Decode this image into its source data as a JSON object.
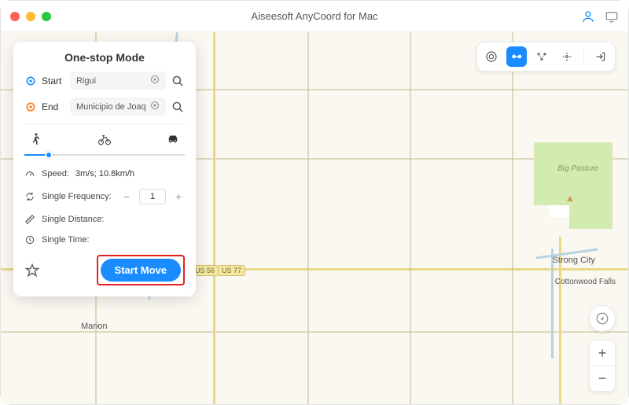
{
  "titlebar": {
    "title": "Aiseesoft AnyCoord for Mac"
  },
  "panel": {
    "title": "One-stop Mode",
    "start_label": "Start",
    "start_value": "Rigui",
    "end_label": "End",
    "end_value": "Municipio de Joaquín V. Gon",
    "speed_label": "Speed:",
    "speed_value": "3m/s; 10.8km/h",
    "frequency_label": "Single Frequency:",
    "frequency_value": "1",
    "distance_label": "Single Distance:",
    "distance_value": "",
    "time_label": "Single Time:",
    "time_value": "",
    "start_move": "Start Move"
  },
  "map": {
    "shields": [
      "US 56",
      "US 77"
    ],
    "city_marion": "Marion",
    "city_strong": "Strong City",
    "city_cottonwood": "Cottonwood Falls",
    "park_label": "Big Pasture"
  },
  "zoom": {
    "in": "+",
    "out": "−"
  }
}
